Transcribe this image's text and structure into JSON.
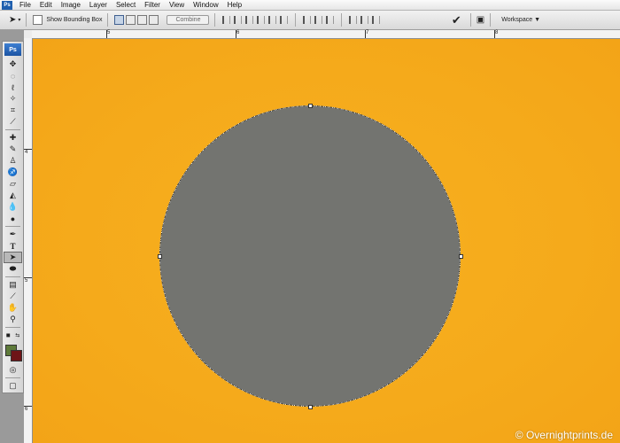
{
  "app": {
    "logo_small": "Ps",
    "logo_toolbox": "Ps"
  },
  "menu": [
    "File",
    "Edit",
    "Image",
    "Layer",
    "Select",
    "Filter",
    "View",
    "Window",
    "Help"
  ],
  "options_bar": {
    "show_bounding_box_label": "Show Bounding Box",
    "show_bounding_box_checked": false,
    "combine_label": "Combine",
    "commit_glyph": "✔",
    "workspace_label": "Workspace"
  },
  "rulers": {
    "top_labels": [
      "5",
      "6",
      "7",
      "8"
    ],
    "left_labels": [
      "4",
      "5",
      "6"
    ]
  },
  "toolbox": {
    "tools": [
      "move-tool",
      "marquee-tool",
      "lasso-tool",
      "magic-wand-tool",
      "crop-tool",
      "slice-tool",
      "healing-brush-tool",
      "brush-tool",
      "clone-stamp-tool",
      "history-brush-tool",
      "eraser-tool",
      "paint-bucket-tool",
      "blur-tool",
      "dodge-tool",
      "pen-tool",
      "type-tool",
      "path-selection-tool",
      "ellipse-tool",
      "notes-tool",
      "eyedropper-tool",
      "hand-tool",
      "zoom-tool"
    ],
    "selected_tool": "path-selection-tool",
    "foreground_color": "#5e7a3a",
    "background_color": "#6e1417"
  },
  "canvas": {
    "background_color": "#f5aa1b",
    "shape_color": "#737470",
    "shape": "circle"
  },
  "watermark": "© Overnightprints.de"
}
